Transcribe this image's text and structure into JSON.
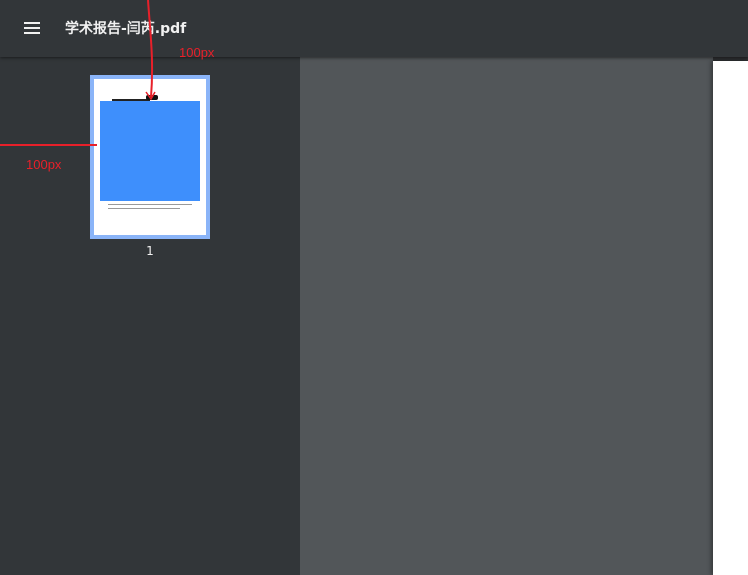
{
  "toolbar": {
    "title": "学术报告-闫芮.pdf",
    "menu_icon": "hamburger-menu-icon"
  },
  "sidebar": {
    "thumbnails": [
      {
        "page_number": "1",
        "selected": true
      }
    ]
  },
  "annotations": {
    "top_label": "100px",
    "left_label": "100px",
    "color": "#e8202a"
  },
  "colors": {
    "toolbar_bg": "#323639",
    "viewer_bg": "#525659",
    "thumb_border": "#8ab4f8",
    "figure": "#3e8ffc"
  }
}
